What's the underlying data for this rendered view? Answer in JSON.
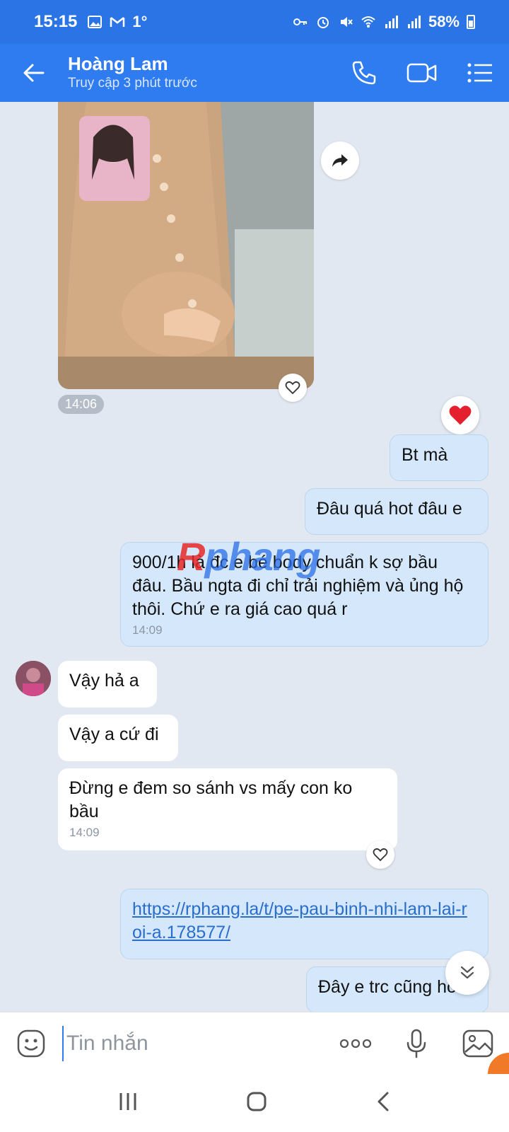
{
  "status_bar": {
    "time": "15:15",
    "temp": "1°",
    "battery": "58%"
  },
  "header": {
    "name": "Hoàng Lam",
    "subtitle": "Truy cập 3 phút trước"
  },
  "messages": {
    "photo_time": "14:06",
    "m1": "Bt mà",
    "m2": "Đâu quá hot đâu e",
    "m3": "900/1h là đc e bé body chuẩn k sợ bầu đâu. Bầu ngta đi chỉ trải nghiệm và ủng hộ thôi. Chứ e ra giá cao quá r",
    "m3_time": "14:09",
    "m4": "Vậy hả a",
    "m5": "Vậy a cứ đi",
    "m6": "Đừng e đem so sánh vs mấy con ko bầu",
    "m6_time": "14:09",
    "m7_link": "https://rphang.la/t/pe-pau-binh-nhi-lam-lai-roi-a.178577/",
    "m8": "Đây e trc cũng hot"
  },
  "watermark": {
    "r": "R",
    "rest": "phang"
  },
  "composer": {
    "placeholder": "Tin nhắn"
  },
  "colors": {
    "header": "#2f7bf0",
    "out_bubble": "#d5e8fb",
    "chat_bg": "#e2e8f1"
  },
  "icons": [
    "back-arrow-icon",
    "phone-icon",
    "video-call-icon",
    "menu-list-icon",
    "forward-icon",
    "heart-icon",
    "emoji-icon",
    "more-icon",
    "mic-icon",
    "image-icon",
    "chevron-down-double-icon"
  ]
}
